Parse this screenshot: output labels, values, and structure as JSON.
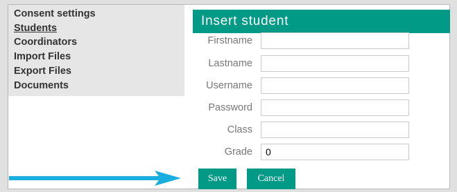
{
  "sidebar": {
    "items": [
      {
        "label": "Consent settings",
        "active": false
      },
      {
        "label": "Students",
        "active": true
      },
      {
        "label": "Coordinators",
        "active": false
      },
      {
        "label": "Import Files",
        "active": false
      },
      {
        "label": "Export Files",
        "active": false
      },
      {
        "label": "Documents",
        "active": false
      }
    ]
  },
  "form": {
    "title": "Insert student",
    "fields": [
      {
        "label": "Firstname",
        "value": ""
      },
      {
        "label": "Lastname",
        "value": ""
      },
      {
        "label": "Username",
        "value": ""
      },
      {
        "label": "Password",
        "value": ""
      },
      {
        "label": "Class",
        "value": ""
      },
      {
        "label": "Grade",
        "value": "0"
      }
    ],
    "save_label": "Save",
    "cancel_label": "Cancel"
  },
  "colors": {
    "accent": "#009a87",
    "arrow": "#1aaee0",
    "sidebar_bg": "#e6e6e6"
  },
  "annotation": {
    "icon": "arrow-right-icon"
  }
}
